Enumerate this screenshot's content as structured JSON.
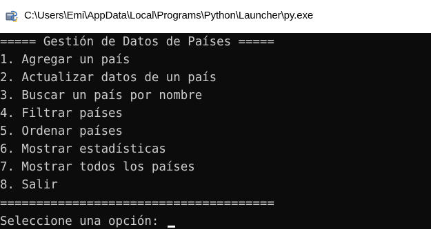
{
  "window": {
    "title": "C:\\Users\\Emi\\AppData\\Local\\Programs\\Python\\Launcher\\py.exe",
    "icon": "python-launcher-icon"
  },
  "console": {
    "lines": [
      "===== Gestión de Datos de Países =====",
      "1. Agregar un país",
      "2. Actualizar datos de un país",
      "3. Buscar un país por nombre",
      "4. Filtrar países",
      "5. Ordenar países",
      "6. Mostrar estadísticas",
      "7. Mostrar todos los países",
      "8. Salir",
      "======================================",
      "Seleccione una opción: "
    ],
    "background": "#0c0c0c",
    "foreground": "#cccccc",
    "cursor_color": "#ffffff"
  }
}
